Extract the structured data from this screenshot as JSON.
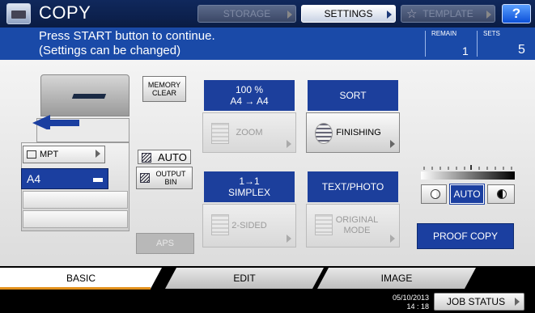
{
  "header": {
    "app_title": "COPY",
    "tabs": [
      {
        "label": "STORAGE",
        "state": "disabled"
      },
      {
        "label": "SETTINGS",
        "state": "enabled"
      },
      {
        "label": "TEMPLATE",
        "state": "disabled"
      }
    ],
    "help_label": "?"
  },
  "message": {
    "line1": "Press START button to continue.",
    "line2": "(Settings can be changed)",
    "remain_label": "REMAIN",
    "remain_value": "1",
    "sets_label": "SETS",
    "sets_value": "5"
  },
  "left_panel": {
    "memory_clear": "MEMORY\nCLEAR",
    "mpt_label": "MPT",
    "paper_size": "A4",
    "auto_label": "AUTO",
    "output_bin": "OUTPUT\nBIN",
    "aps_label": "APS"
  },
  "functions": {
    "zoom_value_line1": "100 %",
    "zoom_value_line2": "A4  →  A4",
    "zoom_label": "ZOOM",
    "sort_value": "SORT",
    "finishing_label": "FINISHING",
    "simplex_line1": "1→1",
    "simplex_line2": "SIMPLEX",
    "two_sided_label": "2-SIDED",
    "mode_value": "TEXT/PHOTO",
    "original_mode_line1": "ORIGINAL",
    "original_mode_line2": "MODE"
  },
  "density": {
    "auto_label": "AUTO",
    "proof_copy_label": "PROOF COPY"
  },
  "bottom_tabs": [
    {
      "label": "BASIC",
      "active": true
    },
    {
      "label": "EDIT",
      "active": false
    },
    {
      "label": "IMAGE",
      "active": false
    }
  ],
  "status": {
    "date": "05/10/2013",
    "time": "14 : 18",
    "job_status_label": "JOB STATUS"
  },
  "colors": {
    "accent_blue": "#1b3fa0",
    "message_bar": "#1a4aa8",
    "active_tab_underline": "#e3911c"
  }
}
